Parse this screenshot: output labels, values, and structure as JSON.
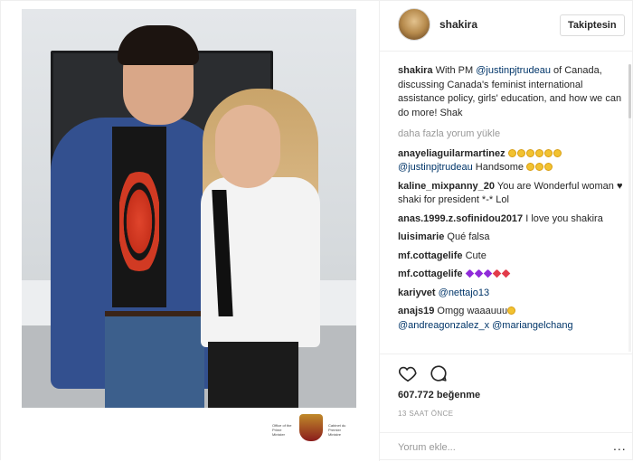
{
  "post": {
    "username": "shakira",
    "follow_label": "Takiptesin",
    "caption_user": "shakira",
    "caption_text_1": "With PM ",
    "caption_mention": "@justinpjtrudeau",
    "caption_text_2": " of Canada, discussing Canada's feminist international assistance policy, girls' education, and how we can do more! Shak",
    "load_more": "daha fazla yorum yükle",
    "likes": "607.772 beğenme",
    "timestamp": "13 SAAT ÖNCE",
    "comment_placeholder": "Yorum ekle...",
    "options_label": "..."
  },
  "crest": {
    "left_text": "Office of the Prime Minister",
    "right_text": "Cabinet du Premier Ministre"
  },
  "comments": [
    {
      "user": "anayeliaguilarmartinez",
      "text": "",
      "mention": "@justinpjtrudeau",
      "text2": " Handsome"
    },
    {
      "user": "kaline_mixpanny_20",
      "text": " You are Wonderful woman ",
      "text2": " shaki for president *-* Lol"
    },
    {
      "user": "anas.1999.z.sofinidou2017",
      "text": " I love you shakira"
    },
    {
      "user": "luisimarie",
      "text": " Qué falsa"
    },
    {
      "user": "mf.cottagelife",
      "text": " Cute"
    },
    {
      "user": "mf.cottagelife",
      "text": " "
    },
    {
      "user": "kariyvet",
      "mention": " @nettajo13"
    },
    {
      "user": "anajs19",
      "text": " Omgg waaauuu",
      "mention": "@andreagonzalez_x",
      "mention2": " @mariangelchang"
    }
  ],
  "icons": {
    "like": "heart-icon",
    "comment": "comment-bubble-icon",
    "options": "more-options-icon"
  },
  "colors": {
    "link": "#003569",
    "muted": "#999999",
    "text": "#262626"
  }
}
